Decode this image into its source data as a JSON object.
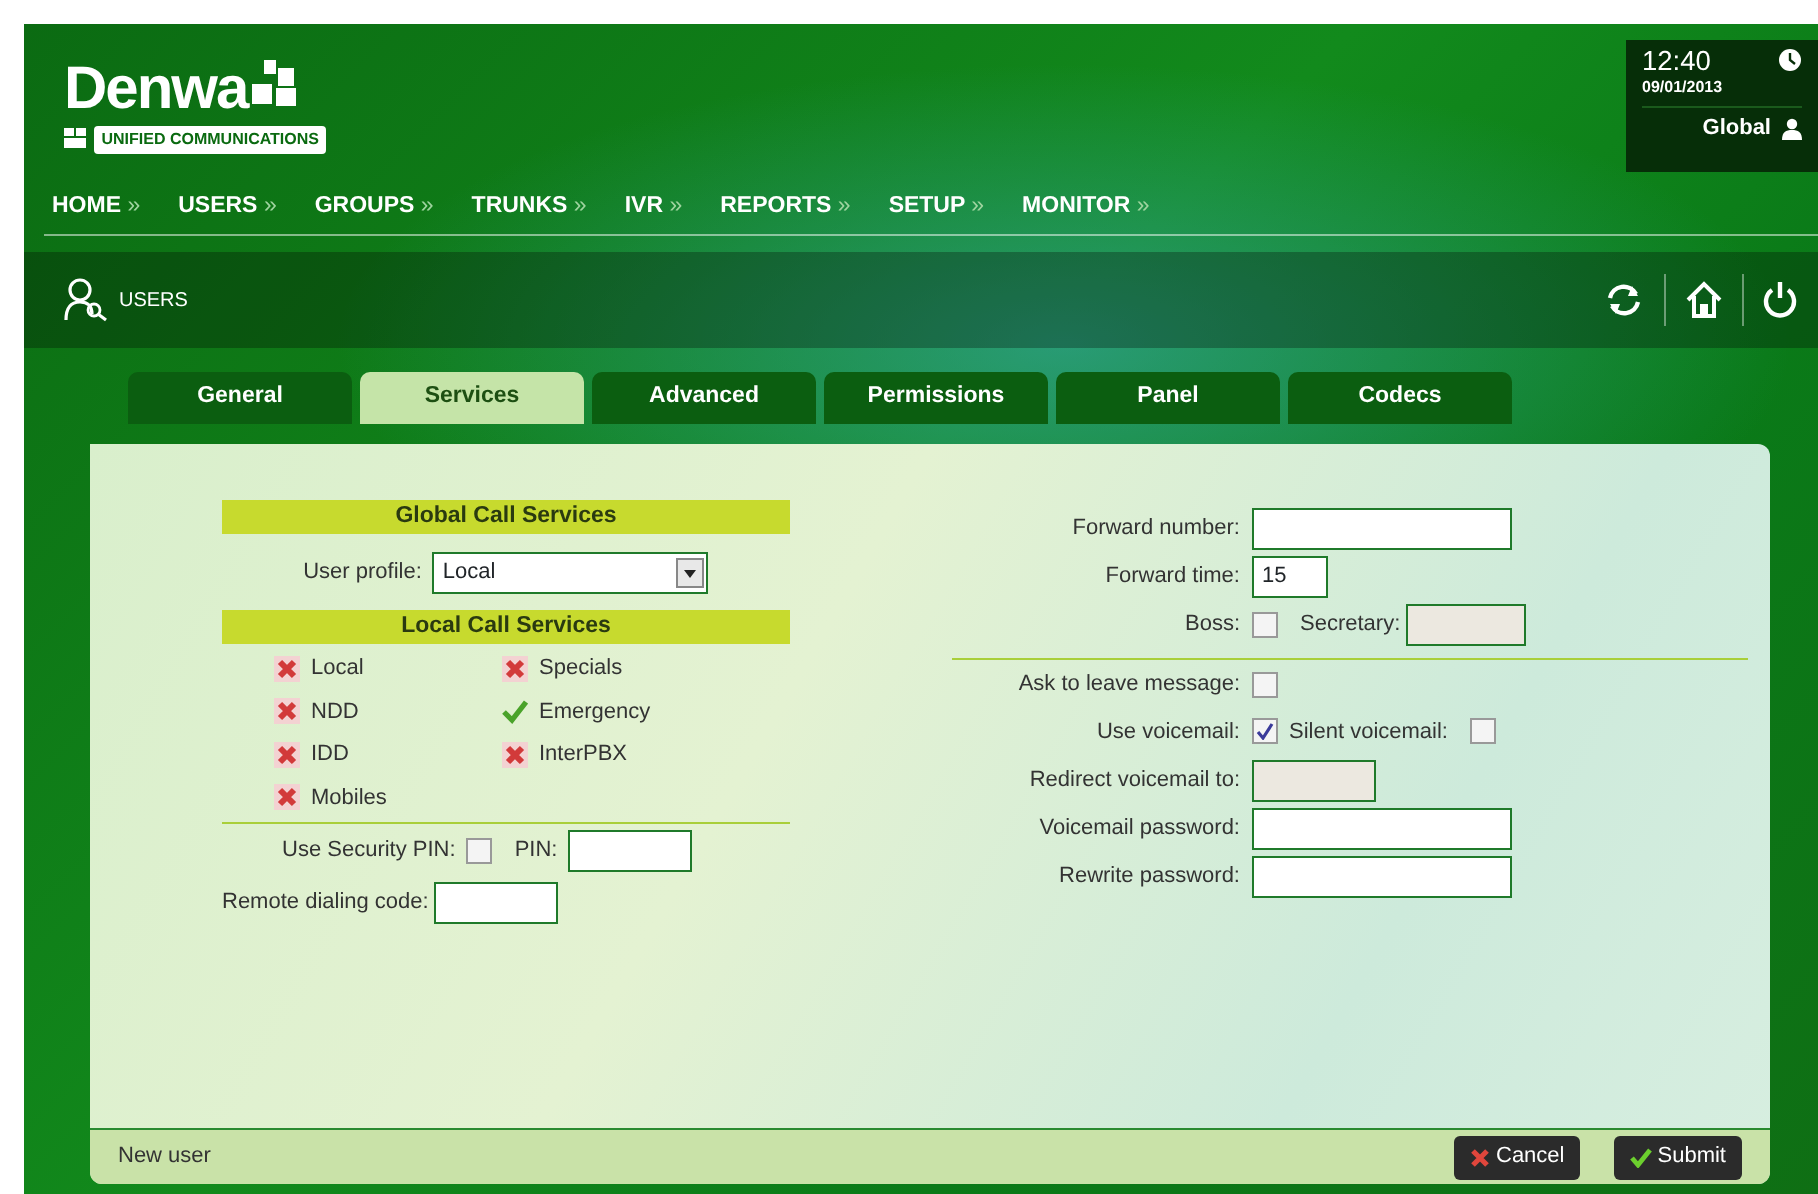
{
  "header": {
    "logo": "Denwa",
    "tagline": "UNIFIED COMMUNICATIONS",
    "time": "12:40",
    "date": "09/01/2013",
    "scope": "Global"
  },
  "nav": [
    {
      "label": "HOME",
      "arrow": "»"
    },
    {
      "label": "USERS",
      "arrow": "»"
    },
    {
      "label": "GROUPS",
      "arrow": "»"
    },
    {
      "label": "TRUNKS",
      "arrow": "»"
    },
    {
      "label": "IVR",
      "arrow": "»"
    },
    {
      "label": "REPORTS",
      "arrow": "»"
    },
    {
      "label": "SETUP",
      "arrow": "»"
    },
    {
      "label": "MONITOR",
      "arrow": "»"
    }
  ],
  "section": {
    "title": "USERS"
  },
  "tabs": [
    {
      "label": "General",
      "selected": false
    },
    {
      "label": "Services",
      "selected": true
    },
    {
      "label": "Advanced",
      "selected": false
    },
    {
      "label": "Permissions",
      "selected": false
    },
    {
      "label": "Panel",
      "selected": false
    },
    {
      "label": "Codecs",
      "selected": false
    }
  ],
  "global_services": {
    "title": "Global Call Services",
    "profile_label": "User profile:",
    "profile_value": "Local"
  },
  "local_services": {
    "title": "Local Call Services",
    "items": [
      {
        "label": "Local",
        "allowed": false
      },
      {
        "label": "Specials",
        "allowed": false
      },
      {
        "label": "NDD",
        "allowed": false
      },
      {
        "label": "Emergency",
        "allowed": true
      },
      {
        "label": "IDD",
        "allowed": false
      },
      {
        "label": "InterPBX",
        "allowed": false
      },
      {
        "label": "Mobiles",
        "allowed": false
      }
    ]
  },
  "pin": {
    "label": "Use Security PIN:",
    "checked": false,
    "pin_label": "PIN:"
  },
  "remote_code": {
    "label": "Remote dialing code:"
  },
  "forward_number": {
    "label": "Forward number:"
  },
  "forward_time": {
    "label": "Forward time:",
    "value": "15"
  },
  "boss": {
    "label": "Boss:",
    "checked": false,
    "secretary_label": "Secretary:",
    "secretary_disabled": true
  },
  "ask_message": {
    "label": "Ask to leave message:",
    "checked": false
  },
  "voicemail": {
    "label": "Use voicemail:",
    "checked": true,
    "silent_label": "Silent voicemail:",
    "silent_checked": false
  },
  "redirect": {
    "label": "Redirect voicemail to:",
    "disabled": true
  },
  "vm_password": {
    "label": "Voicemail password:"
  },
  "rewrite_password": {
    "label": "Rewrite password:"
  },
  "footer": {
    "status": "New user",
    "buttons": [
      {
        "label": "Cancel",
        "kind": "cancel"
      },
      {
        "label": "Submit",
        "kind": "submit"
      }
    ]
  }
}
